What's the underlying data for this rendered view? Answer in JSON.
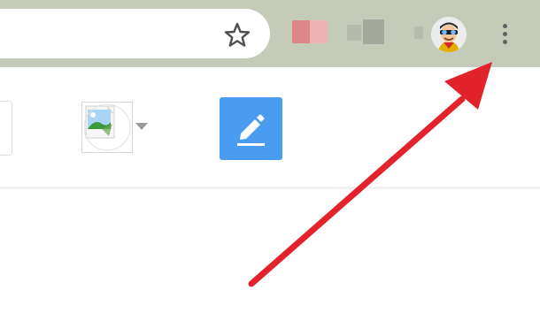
{
  "browser": {
    "address_text": "",
    "icons": {
      "bookmark": "star-icon",
      "menu": "kebab-menu-icon",
      "avatar": "profile-avatar"
    }
  },
  "content": {
    "image_button_icon": "image-icon",
    "compose_icon": "pencil-icon"
  },
  "annotation": {
    "arrow_color": "#e3232c",
    "target": "kebab-menu-icon"
  },
  "colors": {
    "toolbar": "#c5cbb9",
    "compose": "#4a9cf0"
  }
}
